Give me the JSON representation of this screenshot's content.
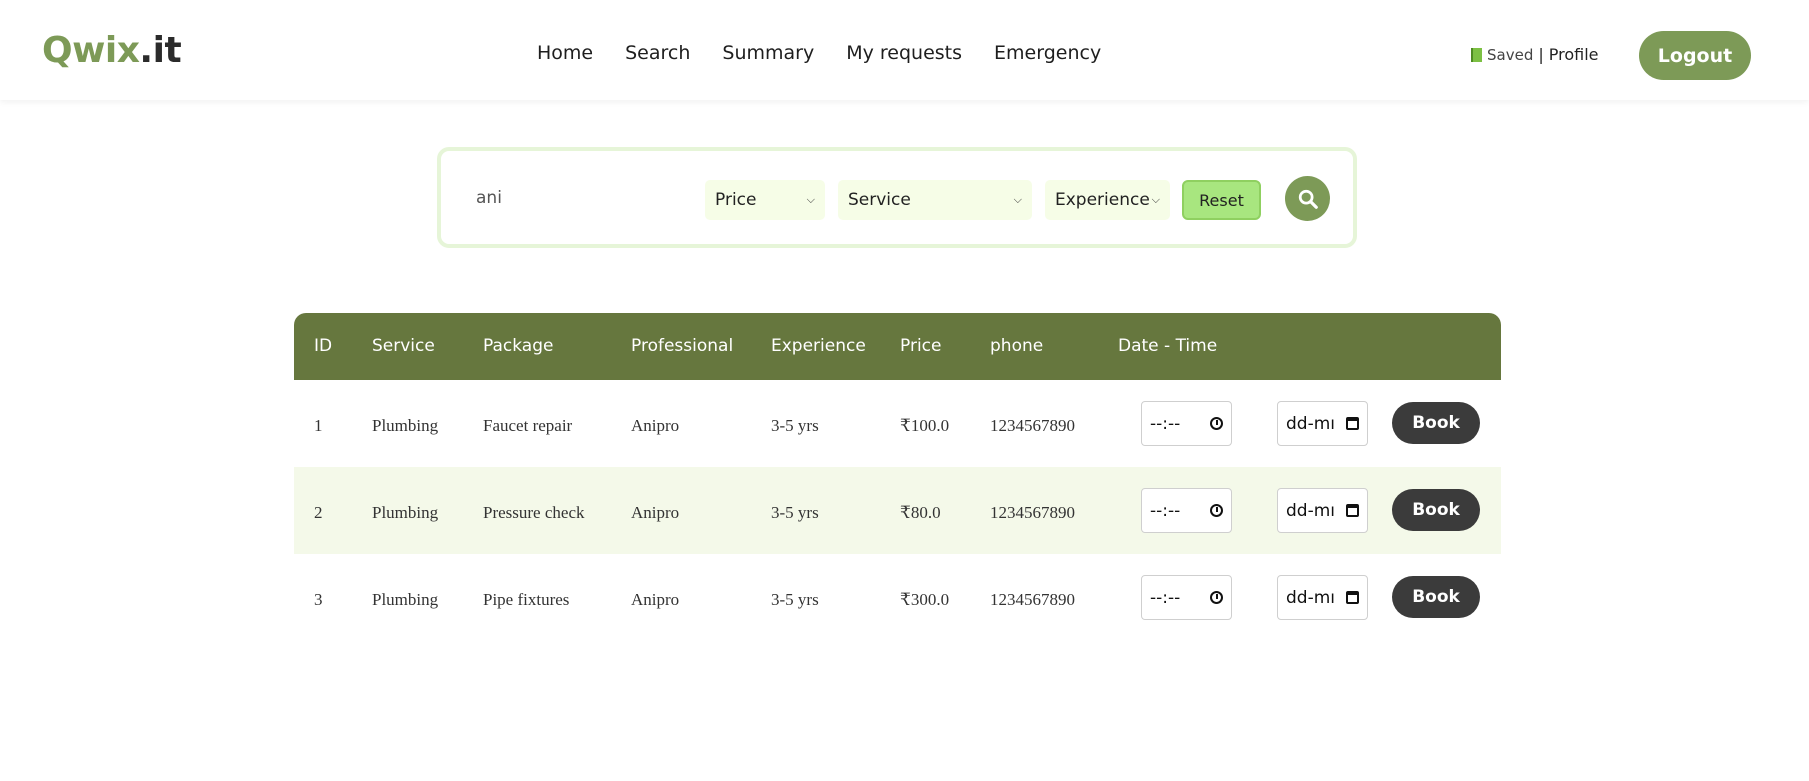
{
  "header": {
    "logo_brand": "Qwix",
    "logo_tld": ".it",
    "nav": [
      "Home",
      "Search",
      "Summary",
      "My requests",
      "Emergency"
    ],
    "saved_label": "Saved",
    "separator": "|",
    "profile_label": "Profile",
    "logout_label": "Logout"
  },
  "search": {
    "query_value": "ani",
    "price_select": "Price",
    "service_select": "Service",
    "experience_select": "Experience",
    "reset_label": "Reset",
    "search_icon": "search-icon"
  },
  "table": {
    "columns": [
      "ID",
      "Service",
      "Package",
      "Professional",
      "Experience",
      "Price",
      "phone",
      "Date - Time"
    ],
    "rows": [
      {
        "id": "1",
        "service": "Plumbing",
        "package": "Faucet repair",
        "professional": "Anipro",
        "experience": "3-5 yrs",
        "price": "₹100.0",
        "phone": "1234567890",
        "time_placeholder": "--:--",
        "date_placeholder": "dd-mı",
        "book_label": "Book"
      },
      {
        "id": "2",
        "service": "Plumbing",
        "package": "Pressure check",
        "professional": "Anipro",
        "experience": "3-5 yrs",
        "price": "₹80.0",
        "phone": "1234567890",
        "time_placeholder": "--:--",
        "date_placeholder": "dd-mı",
        "book_label": "Book"
      },
      {
        "id": "3",
        "service": "Plumbing",
        "package": "Pipe fixtures",
        "professional": "Anipro",
        "experience": "3-5 yrs",
        "price": "₹300.0",
        "phone": "1234567890",
        "time_placeholder": "--:--",
        "date_placeholder": "dd-mı",
        "book_label": "Book"
      }
    ]
  },
  "colors": {
    "brand_green": "#7d9a57",
    "table_header": "#66773e",
    "row_alt": "#f4f9e9",
    "reset_bg": "#a8e67f",
    "book_bg": "#3b3b3b"
  }
}
